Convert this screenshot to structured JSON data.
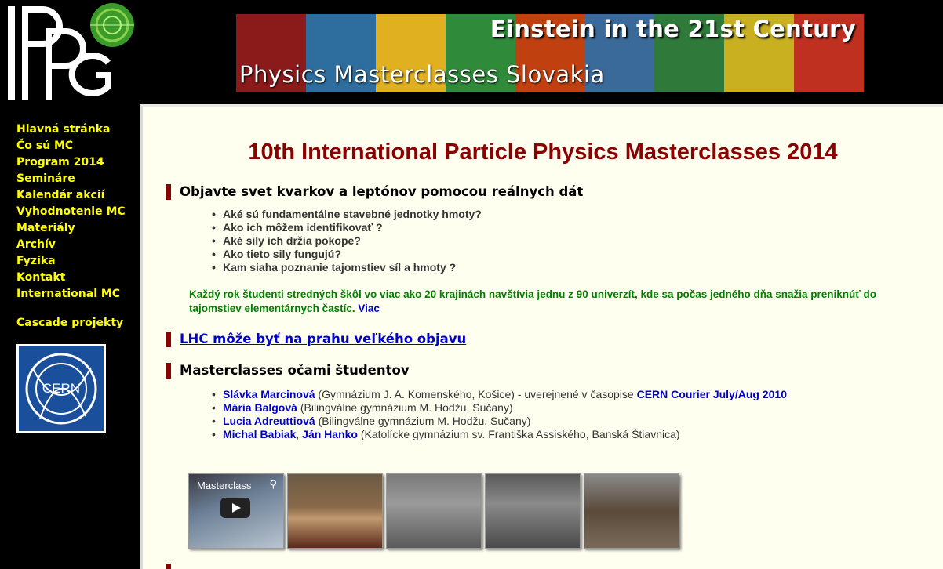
{
  "logo": {
    "name": "IPPOG"
  },
  "banner": {
    "title_top": "Einstein in the 21st Century",
    "title_bottom": "Physics Masterclasses Slovakia",
    "stripe_colors": [
      "#8b1a1a",
      "#2e6e9e",
      "#e0b020",
      "#2f8a3a",
      "#c04010",
      "#3a6a9a",
      "#2f7a3a",
      "#c8b020",
      "#c03020"
    ]
  },
  "sidebar": {
    "items": [
      "Hlavná stránka",
      "Čo sú MC",
      "Program 2014",
      "Semináre",
      "Kalendár akcií",
      "Vyhodnotenie MC",
      "Materiály",
      "Archív",
      "Fyzika",
      "Kontakt",
      "International MC"
    ],
    "cascade": "Cascade projekty",
    "cern_logo_text": "CERN"
  },
  "main": {
    "title": "10th International Particle Physics Masterclasses 2014",
    "section1": {
      "heading": "Objavte svet kvarkov a leptónov pomocou reálnych dát",
      "questions": [
        "Aké sú fundamentálne stavebné jednotky hmoty?",
        "Ako ich môžem identifikovať ?",
        "Aké sily ich držia pokope?",
        "Ako tieto sily fungujú?",
        "Kam siaha poznanie tajomstiev síl a hmoty ?"
      ],
      "paragraph": "Každý rok študenti stredných škôl vo viac ako 20 krajinách navštívia jednu z 90 univerzít, kde sa počas jedného dňa snažia preniknúť do tajomstiev elementárnych častíc.",
      "more_link": "Viac"
    },
    "section2": {
      "heading_link": "LHC môže byť na prahu veľkého objavu"
    },
    "section3": {
      "heading": "Masterclasses očami študentov",
      "items": [
        {
          "link": "Slávka Marcinová",
          "text": " (Gymnázium J. A. Komenského, Košice) - uverejnené v časopise ",
          "link2": "CERN Courier July/Aug 2010"
        },
        {
          "link": "Mária Balgová",
          "text": " (Bilingválne gymnázium M. Hodžu, Sučany)"
        },
        {
          "link": "Lucia Adreuttiová",
          "text": " (Bilingválne gymnázium M. Hodžu, Sučany)"
        },
        {
          "link": "Michal Babiak",
          "sep": ", ",
          "link2": "Ján Hanko",
          "text": " (Katolícke gymnázium sv. Františka Assiského, Banská Štiavnica)"
        }
      ]
    },
    "video_label": "Masterclass"
  }
}
